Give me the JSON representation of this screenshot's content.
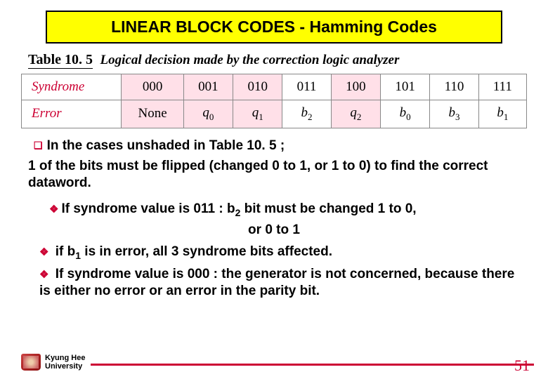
{
  "title": "LINEAR BLOCK CODES - Hamming Codes",
  "table_number": "Table 10. 5",
  "table_caption": "Logical decision made by the correction logic analyzer",
  "table": {
    "headers": [
      "Syndrome",
      "Error"
    ],
    "cols": [
      "000",
      "001",
      "010",
      "011",
      "100",
      "101",
      "110",
      "111"
    ],
    "errors_plain": [
      "None",
      "q0",
      "q1",
      "b2",
      "q2",
      "b0",
      "b3",
      "b1"
    ]
  },
  "note1_prefix": "In the cases unshaded  in Table 10. 5 ;",
  "body1": "    1 of the bits must be flipped (changed 0 to 1, or 1 to 0) to find the correct dataword.",
  "dia1_a": "If syndrome value is 011 : b",
  "dia1_sub": "2",
  "dia1_b": " bit must be changed 1 to 0,",
  "center": "or  0 to 1",
  "dia2_a": " if b",
  "dia2_sub": "1",
  "dia2_b": " is in error, all 3 syndrome bits affected.",
  "dia3": " If syndrome value is 000 : the generator is not concerned, because there is either no error or an error in the parity bit.",
  "university": {
    "l1": "Kyung Hee",
    "l2": "University"
  },
  "page": "51"
}
